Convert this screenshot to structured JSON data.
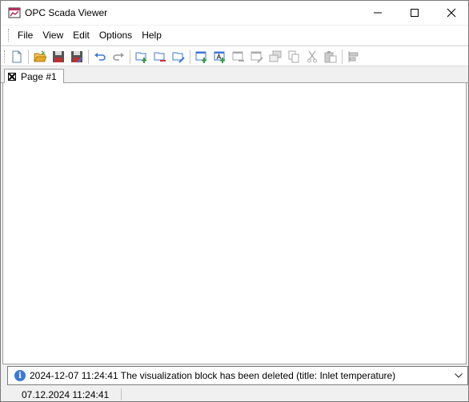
{
  "window": {
    "title": "OPC Scada Viewer",
    "caption_icons": [
      "minimize-icon",
      "maximize-icon",
      "close-icon"
    ]
  },
  "menu": {
    "items": [
      {
        "label": "File"
      },
      {
        "label": "View"
      },
      {
        "label": "Edit"
      },
      {
        "label": "Options"
      },
      {
        "label": "Help"
      }
    ]
  },
  "toolbar": {
    "buttons": [
      {
        "name": "new-icon"
      },
      {
        "name": "open-folder-icon"
      },
      {
        "name": "save-icon"
      },
      {
        "name": "save-as-icon"
      },
      {
        "name": "undo-icon"
      },
      {
        "name": "redo-icon"
      },
      {
        "name": "add-page-icon"
      },
      {
        "name": "remove-page-icon"
      },
      {
        "name": "edit-page-icon"
      },
      {
        "name": "add-block-icon"
      },
      {
        "name": "add-text-block-icon"
      },
      {
        "name": "remove-block-icon"
      },
      {
        "name": "edit-block-icon"
      },
      {
        "name": "bring-to-front-icon"
      },
      {
        "name": "copy-icon"
      },
      {
        "name": "cut-icon"
      },
      {
        "name": "paste-icon"
      },
      {
        "name": "align-left-icon"
      }
    ]
  },
  "tabs": [
    {
      "label": "Page #1"
    }
  ],
  "log": {
    "message": "2024-12-07 11:24:41 The visualization block has been deleted (title: Inlet temperature)"
  },
  "status": {
    "datetime": "07.12.2024 11:24:41"
  },
  "colors": {
    "accent_blue": "#3c78d8",
    "add_green": "#2e9b3a",
    "remove_red": "#d03030",
    "folder_yellow": "#e8a92a"
  }
}
